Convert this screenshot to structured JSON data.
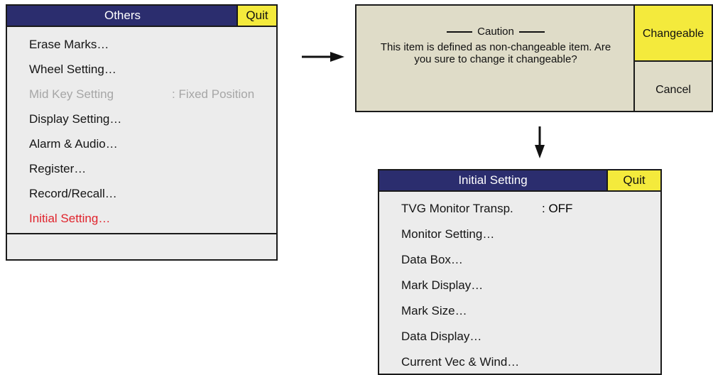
{
  "others_menu": {
    "title": "Others",
    "quit_label": "Quit",
    "items": [
      {
        "label": "Erase Marks…",
        "state": "normal"
      },
      {
        "label": "Wheel Setting…",
        "state": "normal"
      },
      {
        "label": "Mid Key Setting",
        "value": ": Fixed Position",
        "state": "disabled"
      },
      {
        "label": "Display Setting…",
        "state": "normal"
      },
      {
        "label": "Alarm & Audio…",
        "state": "normal"
      },
      {
        "label": "Register…",
        "state": "normal"
      },
      {
        "label": "Record/Recall…",
        "state": "normal"
      },
      {
        "label": "Initial Setting…",
        "state": "selected"
      }
    ]
  },
  "caution_dialog": {
    "heading": "Caution",
    "message": "This item is defined as non-changeable item. Are you sure to change it changeable?",
    "changeable_label": "Changeable",
    "cancel_label": "Cancel"
  },
  "initial_setting_menu": {
    "title": "Initial Setting",
    "quit_label": "Quit",
    "items": [
      {
        "label": "TVG Monitor Transp.",
        "value": ": OFF"
      },
      {
        "label": "Monitor Setting…"
      },
      {
        "label": "Data Box…"
      },
      {
        "label": "Mark Display…"
      },
      {
        "label": "Mark Size…"
      },
      {
        "label": "Data Display…"
      },
      {
        "label": "Current Vec & Wind…"
      }
    ]
  },
  "colors": {
    "title_bar": "#2b2d6e",
    "quit_button": "#f4ea3c",
    "menu_background": "#ececec",
    "dialog_background": "#dfdcc8",
    "highlight_text": "#e0232c",
    "disabled_text": "#a6a6a6"
  }
}
